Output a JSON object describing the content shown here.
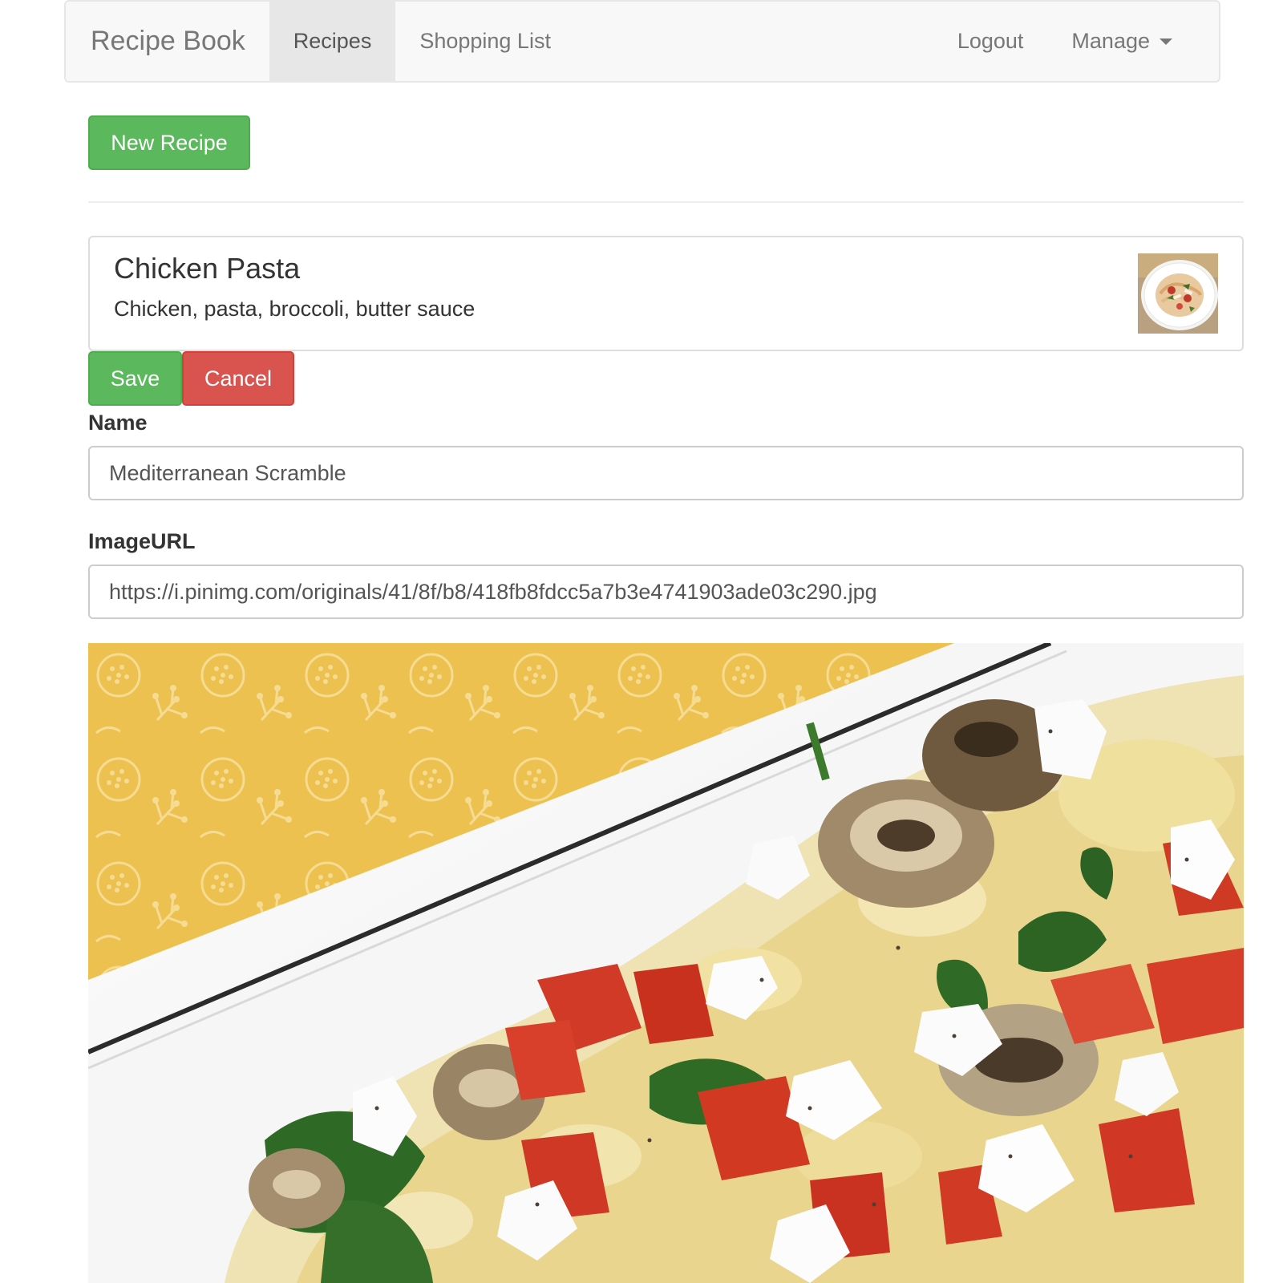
{
  "navbar": {
    "brand": "Recipe Book",
    "links": [
      {
        "label": "Recipes",
        "active": true
      },
      {
        "label": "Shopping List",
        "active": false
      }
    ],
    "logout_label": "Logout",
    "manage_label": "Manage"
  },
  "toolbar": {
    "new_recipe_label": "New Recipe"
  },
  "recipe_list": {
    "items": [
      {
        "name": "Chicken Pasta",
        "description": "Chicken, pasta, broccoli, butter sauce"
      }
    ]
  },
  "edit_form": {
    "save_label": "Save",
    "cancel_label": "Cancel",
    "name_label": "Name",
    "name_value": "Mediterranean Scramble",
    "image_url_label": "ImageURL",
    "image_url_value": "https://i.pinimg.com/originals/41/8f/b8/418fb8fdcc5a7b3e4741903ade03c290.jpg"
  },
  "colors": {
    "success": "#5cb85c",
    "danger": "#d9534f",
    "navbar_bg": "#f8f8f8",
    "active_tab_bg": "#e7e7e7"
  }
}
